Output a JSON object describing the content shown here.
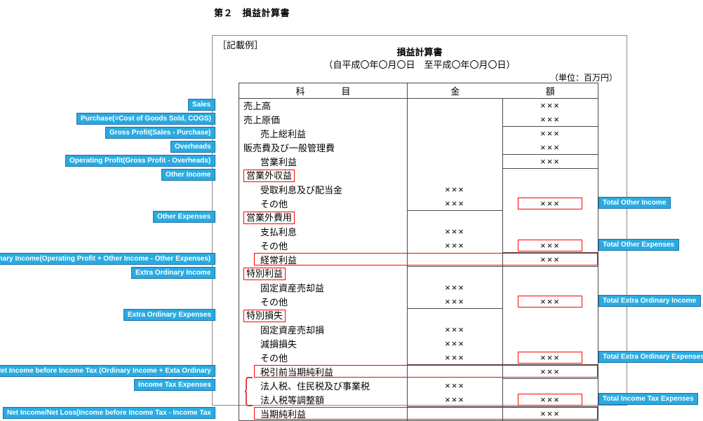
{
  "document": {
    "section_title": "第２　損益計算書",
    "example_marker": "［記載例］",
    "statement_title": "損益計算書",
    "statement_period": "（自平成〇年〇月〇日　至平成〇年〇月〇日）",
    "unit_note": "（単位：百万円）"
  },
  "table": {
    "headers": {
      "item": "科　　　　目",
      "amount_left": "金",
      "amount_right": "額"
    },
    "amount_placeholder": "××××",
    "rows": [
      {
        "label": "売上高",
        "indent": 0,
        "boxed": false,
        "mid": "",
        "right": "×××"
      },
      {
        "label": "売上原価",
        "indent": 0,
        "boxed": false,
        "mid": "",
        "right": "×××"
      },
      {
        "label": "売上総利益",
        "indent": 1,
        "boxed": false,
        "mid": "",
        "right": "×××"
      },
      {
        "label": "販売費及び一般管理費",
        "indent": 0,
        "boxed": false,
        "mid": "",
        "right": "×××"
      },
      {
        "label": "営業利益",
        "indent": 1,
        "boxed": false,
        "mid": "",
        "right": "×××"
      },
      {
        "label": "営業外収益",
        "indent": 0,
        "boxed": true,
        "mid": "",
        "right": ""
      },
      {
        "label": "受取利息及び配当金",
        "indent": 1,
        "boxed": false,
        "mid": "×××",
        "right": ""
      },
      {
        "label": "その他",
        "indent": 1,
        "boxed": false,
        "mid": "×××",
        "right": "×××"
      },
      {
        "label": "営業外費用",
        "indent": 0,
        "boxed": true,
        "mid": "",
        "right": ""
      },
      {
        "label": "支払利息",
        "indent": 1,
        "boxed": false,
        "mid": "×××",
        "right": ""
      },
      {
        "label": "その他",
        "indent": 1,
        "boxed": false,
        "mid": "×××",
        "right": "×××"
      },
      {
        "label": "経常利益",
        "indent": 1,
        "boxed": false,
        "mid": "",
        "right": "×××"
      },
      {
        "label": "特別利益",
        "indent": 0,
        "boxed": true,
        "mid": "",
        "right": ""
      },
      {
        "label": "固定資産売却益",
        "indent": 1,
        "boxed": false,
        "mid": "×××",
        "right": ""
      },
      {
        "label": "その他",
        "indent": 1,
        "boxed": false,
        "mid": "×××",
        "right": "×××"
      },
      {
        "label": "特別損失",
        "indent": 0,
        "boxed": true,
        "mid": "",
        "right": ""
      },
      {
        "label": "固定資産売却損",
        "indent": 1,
        "boxed": false,
        "mid": "×××",
        "right": ""
      },
      {
        "label": "減損損失",
        "indent": 1,
        "boxed": false,
        "mid": "×××",
        "right": ""
      },
      {
        "label": "その他",
        "indent": 1,
        "boxed": false,
        "mid": "×××",
        "right": "×××"
      },
      {
        "label": "税引前当期純利益",
        "indent": 1,
        "boxed": false,
        "mid": "",
        "right": "×××"
      },
      {
        "label": "法人税、住民税及び事業税",
        "indent": 1,
        "boxed": false,
        "mid": "×××",
        "right": ""
      },
      {
        "label": "法人税等調整額",
        "indent": 1,
        "boxed": false,
        "mid": "×××",
        "right": "×××"
      },
      {
        "label": "当期純利益",
        "indent": 1,
        "boxed": false,
        "mid": "",
        "right": "×××"
      }
    ]
  },
  "annotations": {
    "left": [
      {
        "text": "Sales",
        "row": 0
      },
      {
        "text": "Purchase(=Cost of Goods Sold, COGS)",
        "row": 1
      },
      {
        "text": "Gross Profit(Sales - Purchase)",
        "row": 2
      },
      {
        "text": "Overheads",
        "row": 3
      },
      {
        "text": "Operating Profit(Gross Profit - Overheads)",
        "row": 4
      },
      {
        "text": "Other Income",
        "row": 5
      },
      {
        "text": "Other Expenses",
        "row": 8
      },
      {
        "text": "Ordinary Income(Operating Profit + Other Income - Other Expenses)",
        "row": 11
      },
      {
        "text": "Extra Ordinary Income",
        "row": 12
      },
      {
        "text": "Extra Ordinary Expenses",
        "row": 15
      },
      {
        "text": "Net Income before Income Tax (Ordinary Income + Exta Ordinary",
        "row": 19
      },
      {
        "text": "Income Tax Expenses",
        "row": 20
      },
      {
        "text": "Net Income/Net Loss(Income before Income Tax - Income Tax",
        "row": 22
      }
    ],
    "right": [
      {
        "text": "Total Other Income",
        "row": 7
      },
      {
        "text": "Total Other Expenses",
        "row": 10
      },
      {
        "text": "Total Extra Ordinary Income",
        "row": 14
      },
      {
        "text": "Total Extra Ordinary Expenses",
        "row": 18
      },
      {
        "text": "Total Income Tax Expenses",
        "row": 21
      }
    ]
  },
  "colors": {
    "annotation_fill": "#29abe2",
    "annotation_border": "#1b6fa8",
    "annotation_text": "#ffffff",
    "highlight_red": "#ff0000",
    "table_line": "#4a4a4a",
    "frame_line": "#8a8a8a"
  }
}
